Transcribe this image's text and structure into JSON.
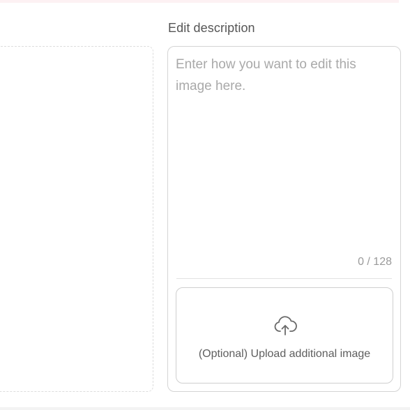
{
  "edit": {
    "label": "Edit description",
    "placeholder": "Enter how you want to edit this image here.",
    "value": "",
    "char_count": "0 / 128"
  },
  "upload": {
    "label": "(Optional) Upload additional image",
    "icon": "cloud-upload-icon"
  },
  "colors": {
    "top_band": "#fdf1f3",
    "panel_border": "#d4d4d4",
    "placeholder": "#a9a9a9"
  }
}
